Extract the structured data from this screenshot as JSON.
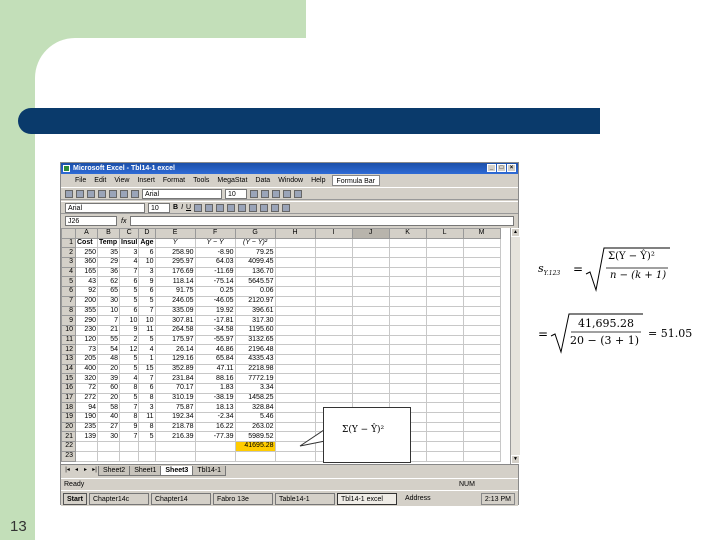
{
  "slide_number": "13",
  "excel": {
    "window_title": "Microsoft Excel - Tbl14-1 excel",
    "menu": [
      "File",
      "Edit",
      "View",
      "Insert",
      "Format",
      "Tools",
      "MegaStat",
      "Data",
      "Window",
      "Help"
    ],
    "formula_bar_button": "Formula Bar",
    "font_name": "Arial",
    "font_size": "10",
    "font_name2": "Arial",
    "font_size2": "10",
    "name_box": "J26",
    "fx": "fx",
    "column_headers": [
      "A",
      "B",
      "C",
      "D",
      "E",
      "F",
      "G",
      "H",
      "I",
      "J",
      "K",
      "L",
      "M"
    ],
    "selected_column": "J",
    "header_row": [
      "Cost",
      "Temp",
      "Insul",
      "Age",
      "Ŷ",
      "Y − Ŷ",
      "(Y − Ŷ)²"
    ],
    "rows": [
      [
        "250",
        "35",
        "3",
        "6",
        "258.90",
        "-8.90",
        "79.25"
      ],
      [
        "360",
        "29",
        "4",
        "10",
        "295.97",
        "64.03",
        "4099.45"
      ],
      [
        "165",
        "36",
        "7",
        "3",
        "176.69",
        "-11.69",
        "136.70"
      ],
      [
        "43",
        "62",
        "6",
        "9",
        "118.14",
        "-75.14",
        "5645.57"
      ],
      [
        "92",
        "65",
        "5",
        "6",
        "91.75",
        "0.25",
        "0.06"
      ],
      [
        "200",
        "30",
        "5",
        "5",
        "246.05",
        "-46.05",
        "2120.97"
      ],
      [
        "355",
        "10",
        "6",
        "7",
        "335.09",
        "19.92",
        "396.61"
      ],
      [
        "290",
        "7",
        "10",
        "10",
        "307.81",
        "-17.81",
        "317.30"
      ],
      [
        "230",
        "21",
        "9",
        "11",
        "264.58",
        "-34.58",
        "1195.60"
      ],
      [
        "120",
        "55",
        "2",
        "5",
        "175.97",
        "-55.97",
        "3132.65"
      ],
      [
        "73",
        "54",
        "12",
        "4",
        "26.14",
        "46.86",
        "2196.48"
      ],
      [
        "205",
        "48",
        "5",
        "1",
        "129.16",
        "65.84",
        "4335.43"
      ],
      [
        "400",
        "20",
        "5",
        "15",
        "352.89",
        "47.11",
        "2218.98"
      ],
      [
        "320",
        "39",
        "4",
        "7",
        "231.84",
        "88.16",
        "7772.19"
      ],
      [
        "72",
        "60",
        "8",
        "6",
        "70.17",
        "1.83",
        "3.34"
      ],
      [
        "272",
        "20",
        "5",
        "8",
        "310.19",
        "-38.19",
        "1458.25"
      ],
      [
        "94",
        "58",
        "7",
        "3",
        "75.87",
        "18.13",
        "328.84"
      ],
      [
        "190",
        "40",
        "8",
        "11",
        "192.34",
        "-2.34",
        "5.46"
      ],
      [
        "235",
        "27",
        "9",
        "8",
        "218.78",
        "16.22",
        "263.02"
      ],
      [
        "139",
        "30",
        "7",
        "5",
        "216.39",
        "-77.39",
        "5989.52"
      ]
    ],
    "total": "41695.28",
    "sheet_tabs": [
      "Sheet2",
      "Sheet1",
      "Sheet3",
      "Tbl14-1"
    ],
    "active_tab": "Sheet3",
    "status_text": "Ready",
    "status_num": "NUM",
    "taskbar": {
      "start": "Start",
      "tasks": [
        "Chapter14c",
        "Chapter14",
        "Fabro 13e",
        "Table14-1",
        "Tbl14-1 excel"
      ],
      "active_task": "Tbl14-1 excel",
      "address": "Address",
      "clock": "2:13 PM"
    }
  },
  "callout_text": "Σ(Y − Ŷ)²",
  "formula": {
    "lhs": "s",
    "lhs_sub": "Y.123",
    "eq": "=",
    "num1": "Σ(Y − Ŷ)²",
    "den1": "n − (k + 1)",
    "eq2": "=",
    "num2": "41,695.28",
    "den2": "20 − (3 + 1)",
    "result": "= 51.05"
  }
}
